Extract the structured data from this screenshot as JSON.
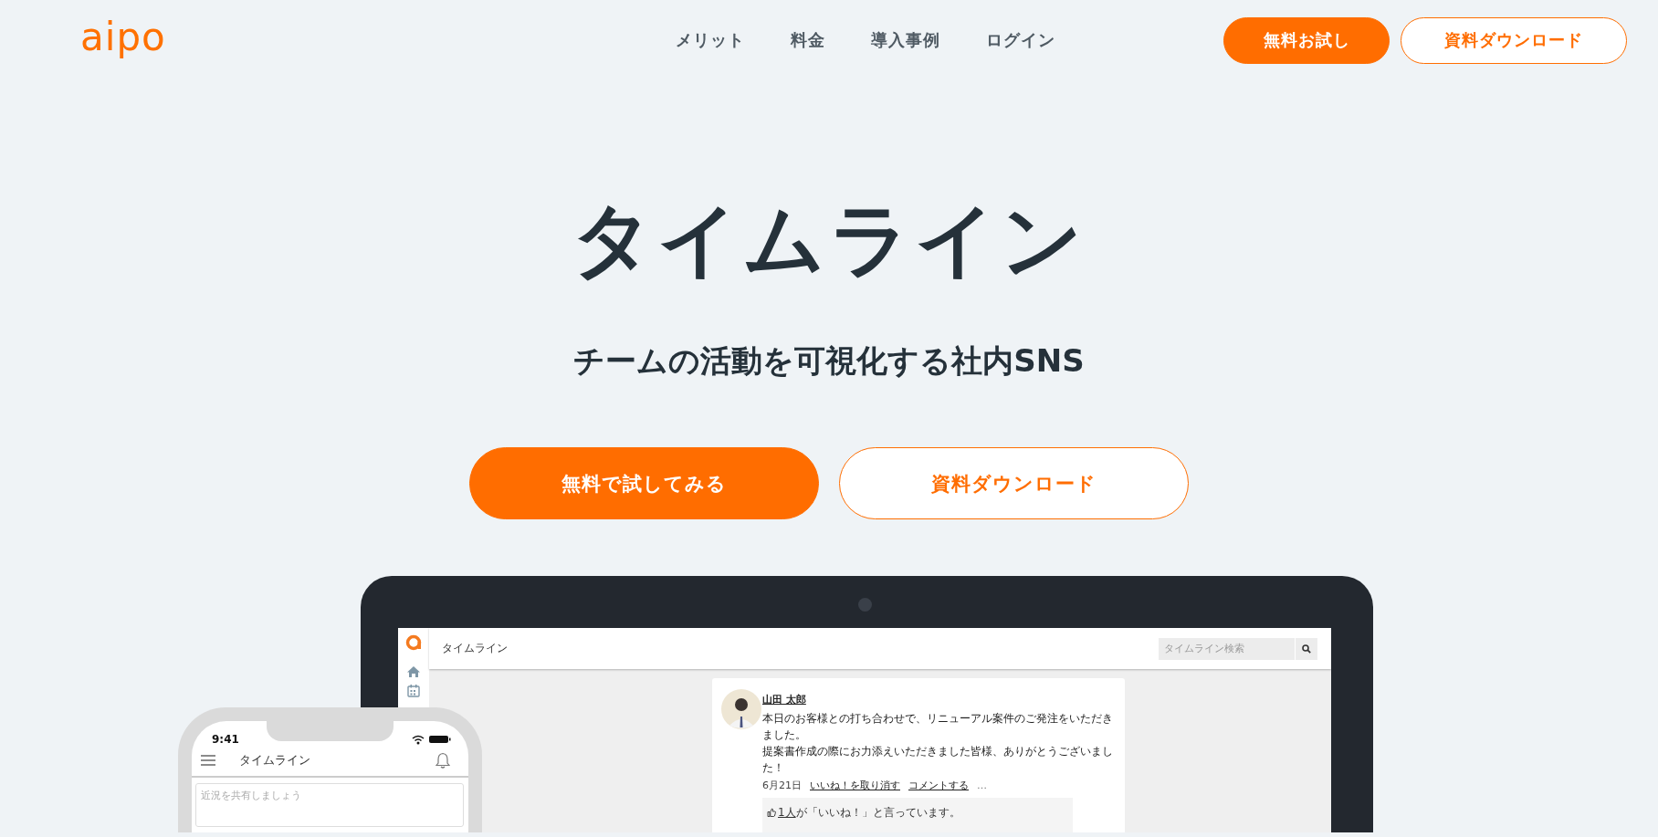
{
  "header": {
    "logo": "aipo",
    "nav": [
      {
        "label": "メリット"
      },
      {
        "label": "料金"
      },
      {
        "label": "導入事例"
      },
      {
        "label": "ログイン"
      }
    ],
    "buttons": [
      {
        "label": "無料お試し",
        "kind": "primary"
      },
      {
        "label": "資料ダウンロード",
        "kind": "outline"
      }
    ]
  },
  "hero": {
    "title": "タイムライン",
    "subtitle": "チームの活動を可視化する社内SNS",
    "buttons": [
      {
        "label": "無料で試してみる",
        "kind": "primary"
      },
      {
        "label": "資料ダウンロード",
        "kind": "outline"
      }
    ]
  },
  "laptop_screen": {
    "title": "タイムライン",
    "search": {
      "placeholder": "タイムライン検索"
    },
    "post": {
      "author": "山田 太郎",
      "paragraphs": [
        "本日のお客様との打ち合わせで、リニューアル案件のご発注をいただきました。",
        "提案書作成の際にお力添えいただきました皆様、ありがとうございました！"
      ],
      "date": "6月21日",
      "actions": [
        "いいね！を取り消す",
        "コメントする"
      ],
      "more": "…",
      "likes": {
        "count": "1人",
        "text": "が「いいね！」と言っています。"
      }
    }
  },
  "phone_screen": {
    "time": "9:41",
    "title": "タイムライン",
    "compose": {
      "placeholder": "近況を共有しましょう"
    }
  }
}
